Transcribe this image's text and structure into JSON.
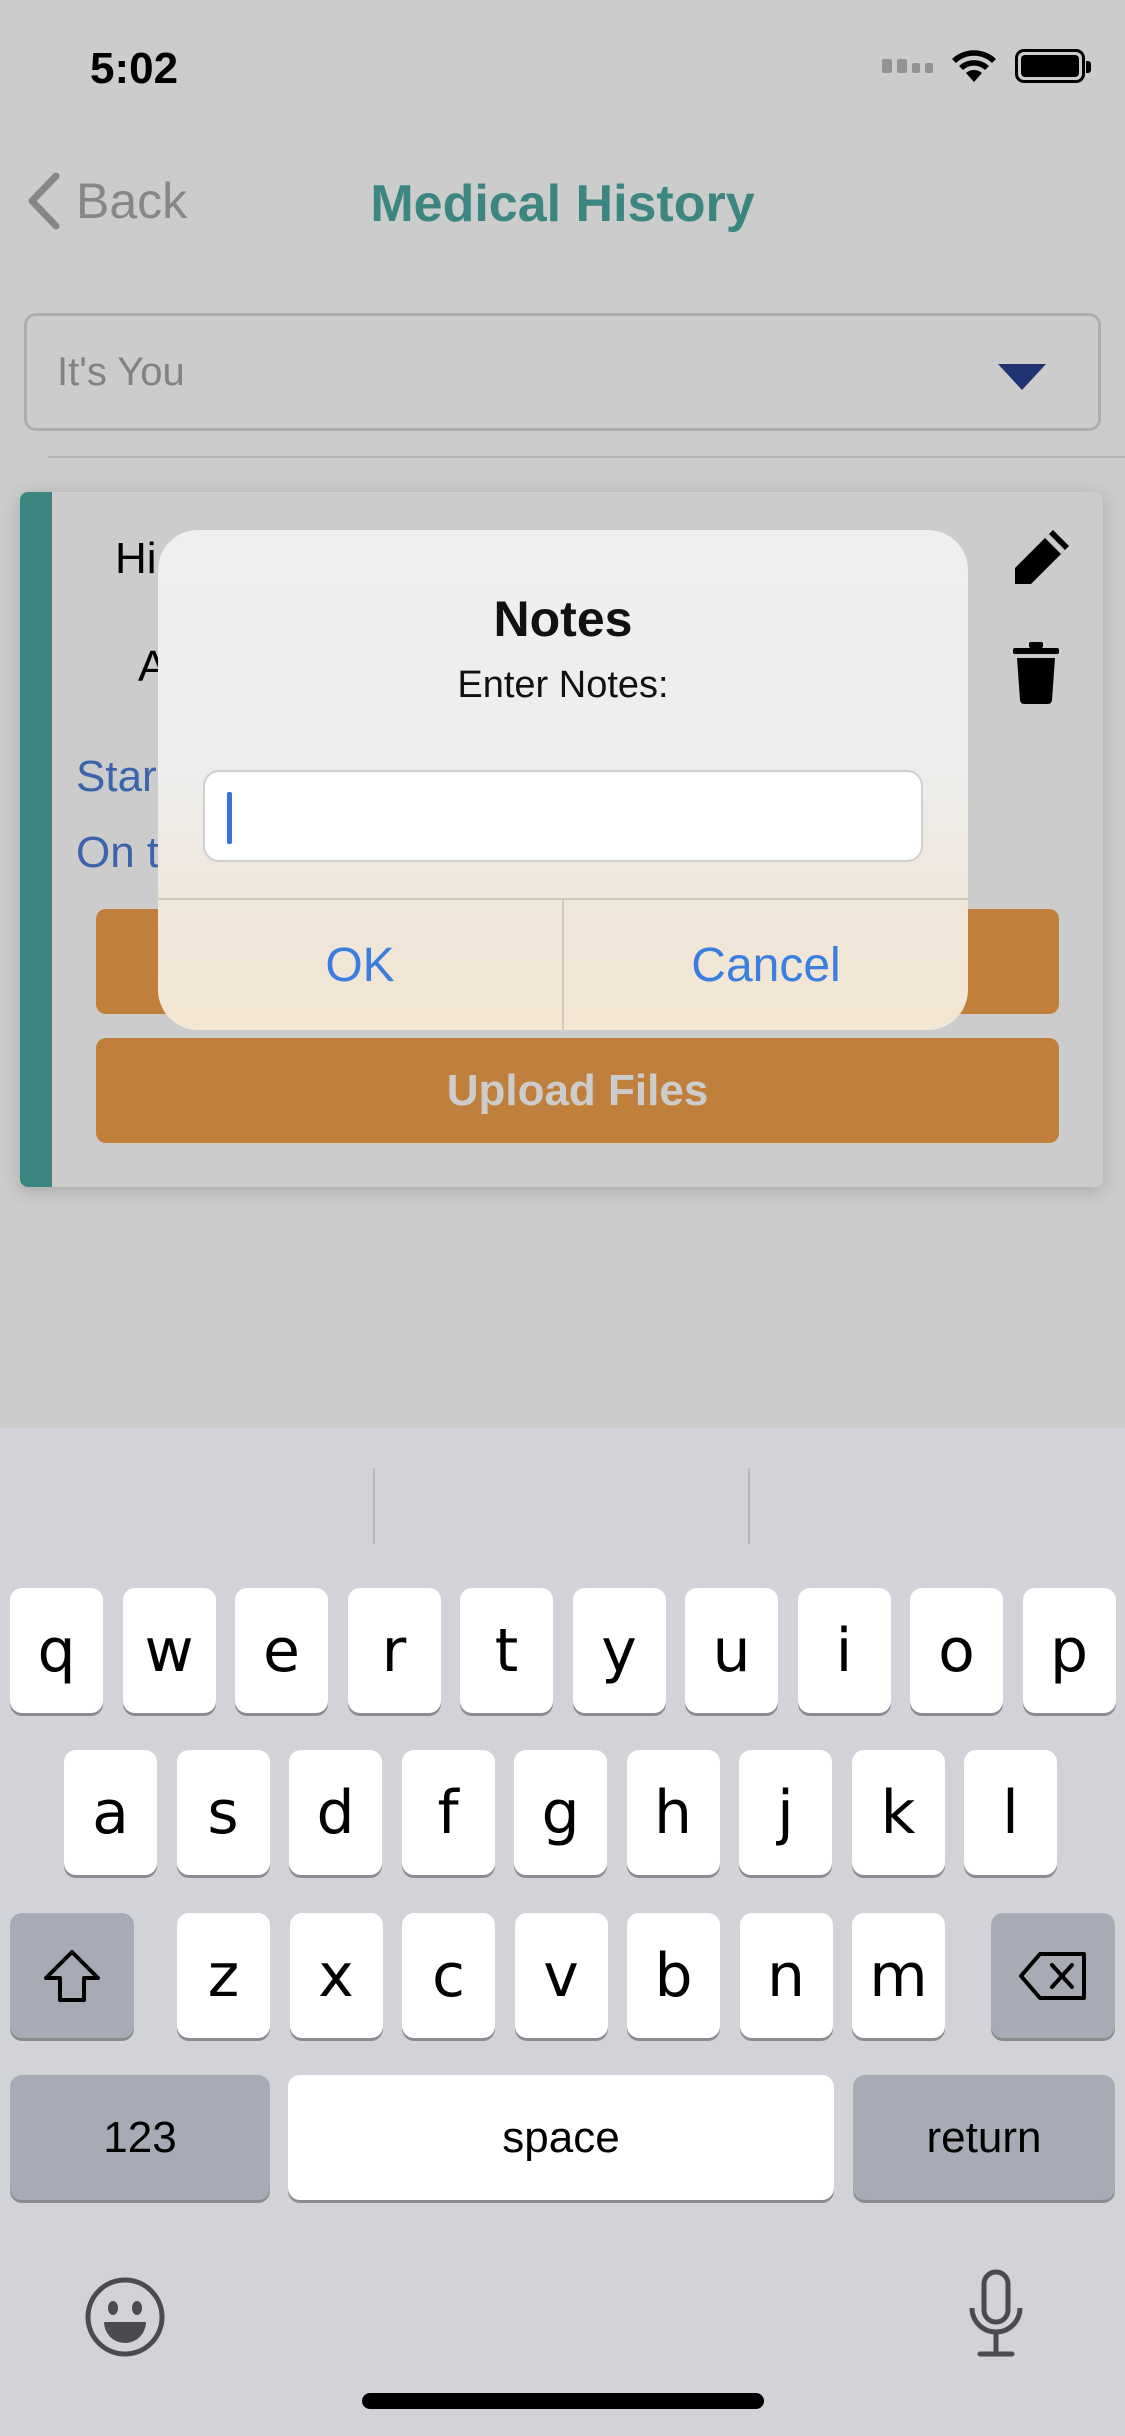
{
  "status_bar": {
    "time": "5:02"
  },
  "nav": {
    "back_label": "Back",
    "title": "Medical History"
  },
  "dropdown": {
    "value": "It's You"
  },
  "card": {
    "line1": "Hi",
    "line2": "A",
    "link1": "Star",
    "link2": "On t",
    "upload_label": "Upload Files"
  },
  "alert": {
    "title": "Notes",
    "message": "Enter Notes:",
    "input_value": "",
    "ok_label": "OK",
    "cancel_label": "Cancel"
  },
  "keyboard": {
    "row1": [
      "q",
      "w",
      "e",
      "r",
      "t",
      "y",
      "u",
      "i",
      "o",
      "p"
    ],
    "row2": [
      "a",
      "s",
      "d",
      "f",
      "g",
      "h",
      "j",
      "k",
      "l"
    ],
    "row3": [
      "z",
      "x",
      "c",
      "v",
      "b",
      "n",
      "m"
    ],
    "numbers_label": "123",
    "space_label": "space",
    "return_label": "return"
  },
  "colors": {
    "accent_teal": "#4aa8a1",
    "button_orange": "#f0a04a",
    "link_blue": "#3a7ee0",
    "caret_navy": "#2a3f8f"
  }
}
